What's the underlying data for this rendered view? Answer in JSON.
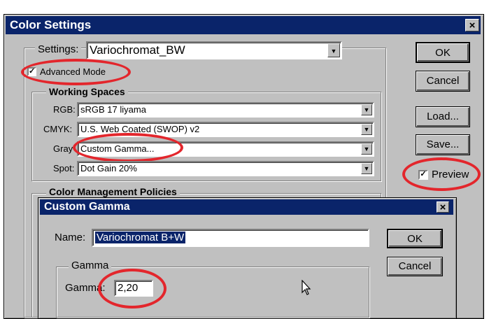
{
  "color_settings": {
    "title": "Color Settings",
    "close_glyph": "×",
    "settings_label": "Settings:",
    "settings_value": "Variochromat_BW",
    "advanced_mode_label": "Advanced Mode",
    "working_spaces_title": "Working Spaces",
    "rgb_label": "RGB:",
    "rgb_value": "sRGB 17 liyama",
    "cmyk_label": "CMYK:",
    "cmyk_value": "U.S. Web Coated (SWOP) v2",
    "gray_label": "Gray",
    "gray_value": "Custom Gamma...",
    "spot_label": "Spot:",
    "spot_value": "Dot Gain 20%",
    "policies_title": "Color Management Policies",
    "ok_label": "OK",
    "cancel_label": "Cancel",
    "load_label": "Load...",
    "save_label": "Save...",
    "preview_label": "Preview",
    "check_glyph": "✓"
  },
  "custom_gamma": {
    "title": "Custom Gamma",
    "close_glyph": "×",
    "name_label": "Name:",
    "name_value": "Variochromat B+W",
    "gamma_group_title": "Gamma",
    "gamma_label": "Gamma:",
    "gamma_value": "2,20",
    "ok_label": "OK",
    "cancel_label": "Cancel"
  },
  "annotation_color": "#e3262c",
  "title_bar_color": "#0a246a"
}
